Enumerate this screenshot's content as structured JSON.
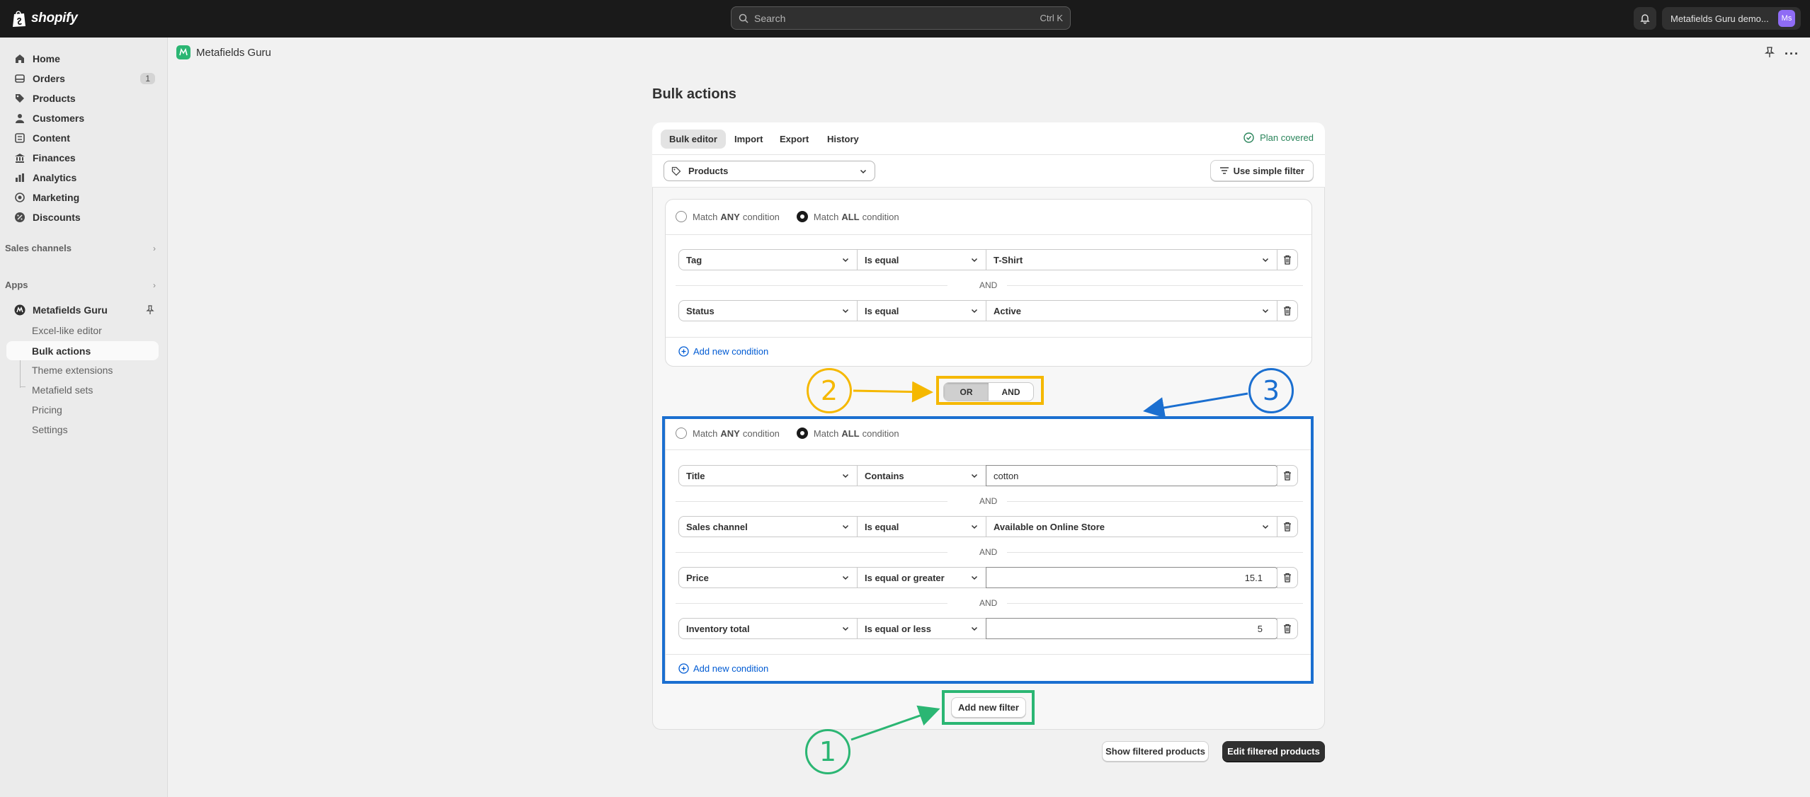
{
  "topbar": {
    "brand": "shopify",
    "search_placeholder": "Search",
    "search_shortcut": "Ctrl K",
    "store_name": "Metafields Guru demo...",
    "avatar_initials": "Ms"
  },
  "sidebar": {
    "items": [
      {
        "label": "Home",
        "icon": "home-icon"
      },
      {
        "label": "Orders",
        "icon": "orders-icon",
        "badge": "1"
      },
      {
        "label": "Products",
        "icon": "tag-icon"
      },
      {
        "label": "Customers",
        "icon": "person-icon"
      },
      {
        "label": "Content",
        "icon": "content-icon"
      },
      {
        "label": "Finances",
        "icon": "bank-icon"
      },
      {
        "label": "Analytics",
        "icon": "chart-icon"
      },
      {
        "label": "Marketing",
        "icon": "target-icon"
      },
      {
        "label": "Discounts",
        "icon": "discount-icon"
      }
    ],
    "sales_channels_label": "Sales channels",
    "apps_label": "Apps",
    "app_name": "Metafields Guru",
    "app_subitems": [
      "Excel-like editor",
      "Bulk actions",
      "Theme extensions",
      "Metafield sets",
      "Pricing",
      "Settings"
    ]
  },
  "app_header": {
    "title": "Metafields Guru"
  },
  "main": {
    "page_title": "Bulk actions",
    "tabs": [
      "Bulk editor",
      "Import",
      "Export",
      "History"
    ],
    "plan_status": "Plan covered",
    "resource_select": "Products",
    "simple_filter_label": "Use simple filter",
    "match_any": {
      "prefix": "Match",
      "bold": "ANY",
      "suffix": "condition"
    },
    "match_all": {
      "prefix": "Match",
      "bold": "ALL",
      "suffix": "condition"
    },
    "filter1": {
      "conditions": [
        {
          "field": "Tag",
          "operator": "Is equal",
          "value": "T-Shirt"
        },
        {
          "field": "Status",
          "operator": "Is equal",
          "value": "Active"
        }
      ]
    },
    "filter2": {
      "conditions": [
        {
          "field": "Title",
          "operator": "Contains",
          "value": "cotton"
        },
        {
          "field": "Sales channel",
          "operator": "Is equal",
          "value": "Available on Online Store"
        },
        {
          "field": "Price",
          "operator": "Is equal or greater",
          "value": "15.1"
        },
        {
          "field": "Inventory total",
          "operator": "Is equal or less",
          "value": "5"
        }
      ]
    },
    "and_label": "AND",
    "add_condition_label": "Add new condition",
    "toggle": {
      "or": "OR",
      "and": "AND",
      "selected": "OR"
    },
    "add_filter_label": "Add new filter",
    "show_filtered_label": "Show filtered products",
    "edit_filtered_label": "Edit filtered products"
  },
  "annotations": {
    "one": "1",
    "two": "2",
    "three": "3",
    "colors": {
      "green": "#2bb673",
      "yellow": "#f5b800",
      "blue": "#1b6fd0"
    }
  }
}
